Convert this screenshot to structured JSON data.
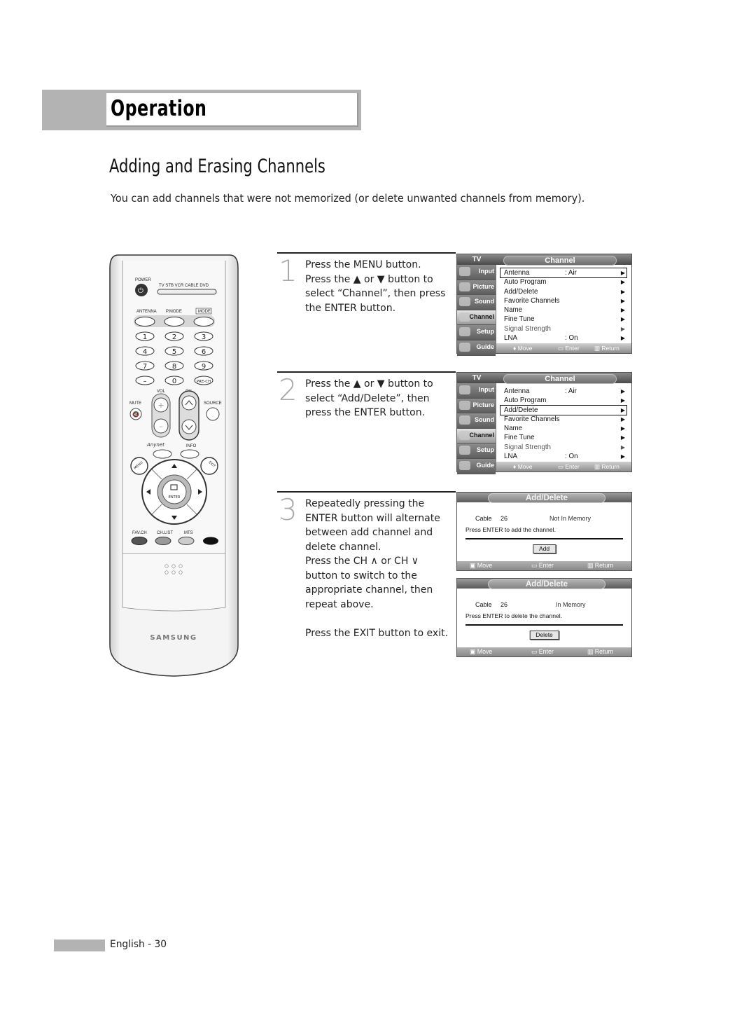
{
  "header": {
    "section_title": "Operation",
    "page_title": "Adding and Erasing Channels",
    "intro": "You can add channels that were not memorized (or delete unwanted channels from memory)."
  },
  "remote": {
    "brand": "SAMSUNG",
    "labels": {
      "power": "POWER",
      "modes": [
        "TV",
        "STB",
        "VCR",
        "CABLE",
        "DVD"
      ],
      "antenna": "ANTENNA",
      "pmode": "P.MODE",
      "mode": "MODE",
      "digits": [
        "1",
        "2",
        "3",
        "4",
        "5",
        "6",
        "7",
        "8",
        "9",
        "–",
        "0"
      ],
      "prech": "PRE-CH",
      "vol": "VOL",
      "ch": "CH",
      "mute": "MUTE",
      "source": "SOURCE",
      "anynet": "Anynet",
      "info": "INFO",
      "menu": "MENU",
      "exit": "EXIT",
      "enter": "ENTER",
      "favch": "FAV.CH",
      "chlist": "CH.LIST",
      "mts": "MTS"
    }
  },
  "steps": [
    {
      "number": "1",
      "text": "Press the MENU button.\nPress the ▲ or ▼ button to\nselect “Channel”, then press\nthe ENTER button."
    },
    {
      "number": "2",
      "text": "Press the ▲ or ▼ button to\nselect “Add/Delete”, then\npress the ENTER button."
    },
    {
      "number": "3",
      "text": "Repeatedly pressing the\nENTER button will alternate\nbetween add channel and\ndelete channel.\nPress the CH ∧ or CH ∨\nbutton to switch to the\nappropriate channel, then\nrepeat above.\n\nPress the EXIT button to exit."
    }
  ],
  "osd_channel": {
    "tv_label": "TV",
    "title": "Channel",
    "sidebar": [
      "Input",
      "Picture",
      "Sound",
      "Channel",
      "Setup",
      "Guide"
    ],
    "active_sidebar": "Channel",
    "rows": [
      {
        "label": "Antenna",
        "value": ": Air"
      },
      {
        "label": "Auto Program",
        "value": ""
      },
      {
        "label": "Add/Delete",
        "value": ""
      },
      {
        "label": "Favorite Channels",
        "value": ""
      },
      {
        "label": "Name",
        "value": ""
      },
      {
        "label": "Fine Tune",
        "value": ""
      },
      {
        "label": "Signal Strength",
        "value": ""
      },
      {
        "label": "LNA",
        "value": ": On"
      }
    ],
    "arrow": "▶",
    "footer": {
      "move": "♦ Move",
      "enter": "▭ Enter",
      "return": "▥ Return"
    },
    "screen1_selected": "Antenna",
    "screen2_selected": "Add/Delete"
  },
  "osd_adddelete": [
    {
      "title": "Add/Delete",
      "source": "Cable",
      "channel": "26",
      "status": "Not In Memory",
      "message": "Press ENTER to add the channel.",
      "button": "Add",
      "footer": {
        "move": "▣ Move",
        "enter": "▭ Enter",
        "return": "▥ Return"
      }
    },
    {
      "title": "Add/Delete",
      "source": "Cable",
      "channel": "26",
      "status": "In Memory",
      "message": "Press ENTER to delete the channel.",
      "button": "Delete",
      "footer": {
        "move": "▣ Move",
        "enter": "▭ Enter",
        "return": "▥ Return"
      }
    }
  ],
  "footer": {
    "page_label": "English - 30"
  }
}
